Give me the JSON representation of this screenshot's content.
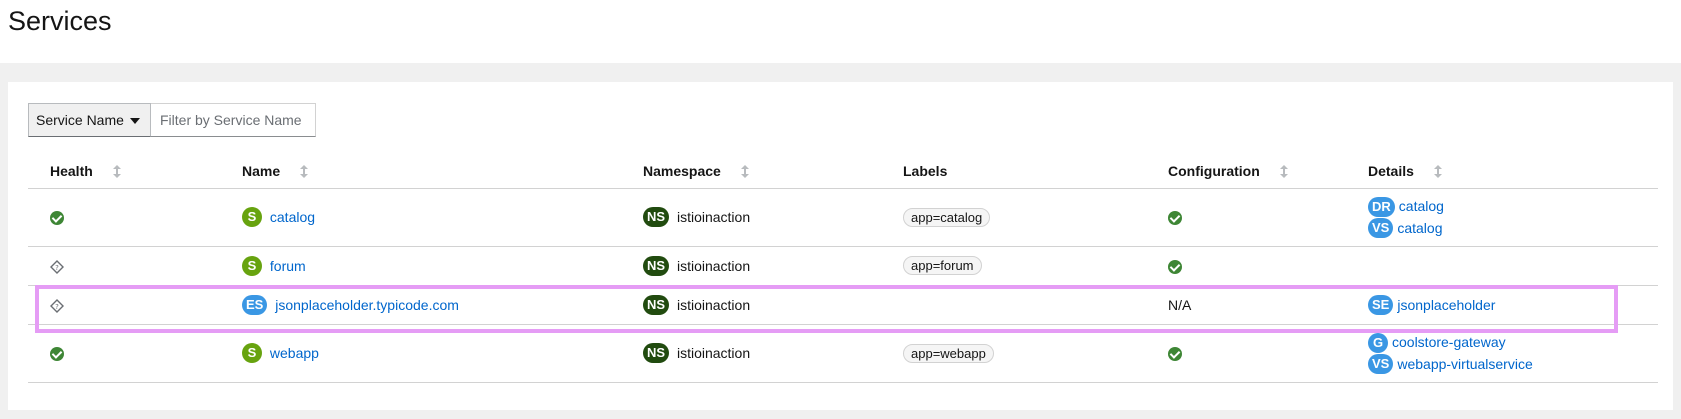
{
  "page": {
    "title": "Services"
  },
  "toolbar": {
    "filter_type": "Service Name",
    "filter_placeholder": "Filter by Service Name"
  },
  "table": {
    "columns": [
      "Health",
      "Name",
      "Namespace",
      "Labels",
      "Configuration",
      "Details"
    ],
    "rows": [
      {
        "health": "healthy",
        "name_badge": "S",
        "name": "catalog",
        "ns_badge": "NS",
        "namespace": "istioinaction",
        "label": "app=catalog",
        "configuration": "ok",
        "details": [
          {
            "badge": "DR",
            "text": "catalog"
          },
          {
            "badge": "VS",
            "text": "catalog"
          }
        ]
      },
      {
        "health": "na",
        "name_badge": "S",
        "name": "forum",
        "ns_badge": "NS",
        "namespace": "istioinaction",
        "label": "app=forum",
        "configuration": "ok",
        "details": []
      },
      {
        "health": "na",
        "name_badge": "ES",
        "name": "jsonplaceholder.typicode.com",
        "ns_badge": "NS",
        "namespace": "istioinaction",
        "label": "",
        "configuration": "N/A",
        "details": [
          {
            "badge": "SE",
            "text": "jsonplaceholder"
          }
        ]
      },
      {
        "health": "healthy",
        "name_badge": "S",
        "name": "webapp",
        "ns_badge": "NS",
        "namespace": "istioinaction",
        "label": "app=webapp",
        "configuration": "ok",
        "details": [
          {
            "badge": "G",
            "text": "coolstore-gateway"
          },
          {
            "badge": "VS",
            "text": "webapp-virtualservice"
          }
        ]
      }
    ]
  },
  "colors": {
    "healthy": "#3e8635",
    "service_badge": "#67a30f",
    "namespace_badge": "#214b0f",
    "resource_badge": "#3a97e4",
    "link": "#0066cc",
    "highlight": "#e59cf5"
  }
}
